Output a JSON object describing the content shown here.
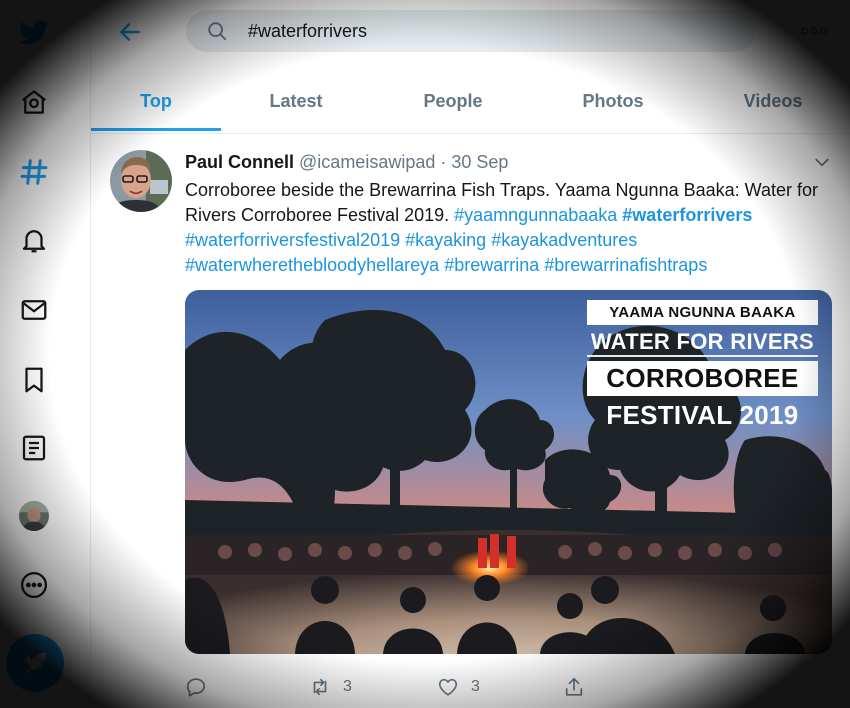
{
  "search": {
    "value": "#waterforrivers"
  },
  "tabs": [
    {
      "label": "Top"
    },
    {
      "label": "Latest"
    },
    {
      "label": "People"
    },
    {
      "label": "Photos"
    },
    {
      "label": "Videos"
    }
  ],
  "nav": {
    "icons": [
      "twitter-logo-icon",
      "home-icon",
      "explore-hashtag-icon",
      "notifications-bell-icon",
      "messages-mail-icon",
      "bookmarks-icon",
      "lists-icon",
      "profile-avatar",
      "more-dots-icon"
    ],
    "compose_icon": "compose-feather-icon"
  },
  "tweet": {
    "name": "Paul Connell",
    "handle": "@icameisawipad",
    "dot": "·",
    "time": "30 Sep",
    "text_plain": "Corroboree beside the Brewarrina Fish Traps. Yaama Ngunna Baaka: Water for Rivers Corroboree Festival 2019.",
    "hashtags": [
      "#yaamngunnabaaka",
      "#waterforrivers",
      "#waterforriversfestival2019",
      "#kayaking",
      "#kayakadventures",
      "#waterwherethebloodyhellareya",
      "#brewarrina",
      "#brewarrinafishtraps"
    ],
    "image_overlay": {
      "line1": "YAAMA NGUNNA BAAKA",
      "line2": "WATER FOR RIVERS",
      "line3": "CORROBOREE",
      "line4": "FESTIVAL 2019"
    },
    "retweets": "3",
    "likes": "3"
  },
  "colors": {
    "accent": "#1da1f2",
    "link": "#1b95e0",
    "secondary_text": "#657786",
    "search_bg": "#e6ecf0"
  }
}
